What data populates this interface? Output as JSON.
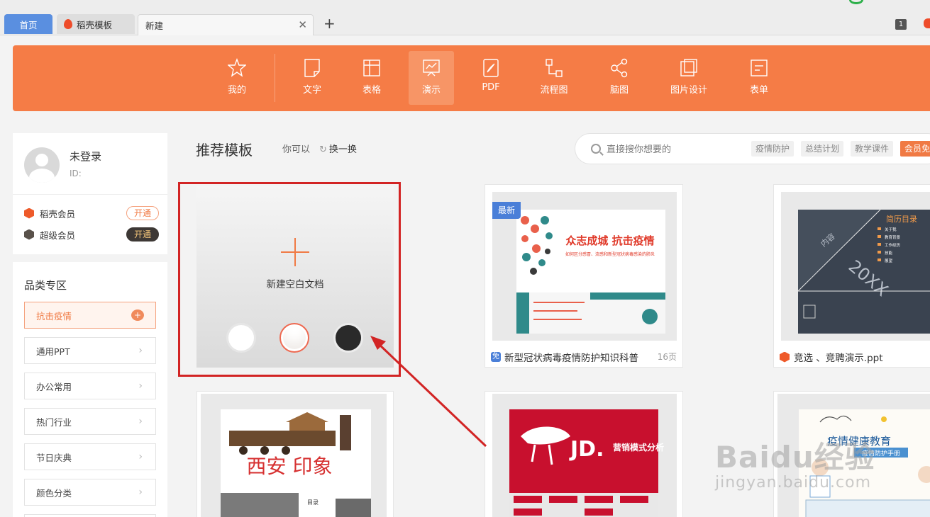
{
  "tabs": {
    "home": "首页",
    "daoke": "稻壳模板",
    "new": "新建",
    "window_count": "1"
  },
  "nav": [
    {
      "label": "我的",
      "icon": "star-icon"
    },
    {
      "label": "文字",
      "icon": "document-icon"
    },
    {
      "label": "表格",
      "icon": "table-icon"
    },
    {
      "label": "演示",
      "icon": "presentation-icon",
      "active": true
    },
    {
      "label": "PDF",
      "icon": "pdf-icon"
    },
    {
      "label": "流程图",
      "icon": "flowchart-icon"
    },
    {
      "label": "脑图",
      "icon": "mindmap-icon"
    },
    {
      "label": "图片设计",
      "icon": "image-design-icon"
    },
    {
      "label": "表单",
      "icon": "form-icon"
    }
  ],
  "user": {
    "name": "未登录",
    "id_label": "ID:",
    "members": [
      {
        "label": "稻壳会员",
        "button": "开通"
      },
      {
        "label": "超级会员",
        "button": "开通"
      }
    ]
  },
  "categories": {
    "title": "品类专区",
    "items": [
      "抗击疫情",
      "通用PPT",
      "办公常用",
      "热门行业",
      "节日庆典",
      "颜色分类"
    ],
    "badge": "+"
  },
  "content": {
    "title": "推荐模板",
    "hint": "你可以",
    "refresh": "换一换"
  },
  "search": {
    "placeholder": "直接搜你想要的",
    "tags": [
      "疫情防护",
      "总结计划",
      "教学课件",
      "会员免"
    ]
  },
  "blank_doc": {
    "label": "新建空白文档"
  },
  "cards": [
    {
      "title": "新型冠状病毒疫情防护知识科普",
      "pages": "16页",
      "tag": "免",
      "badge": "最新"
    },
    {
      "title": "竞选 、竞聘演示.ppt",
      "pages": ""
    }
  ],
  "thumb_text": {
    "covid_head": "众志成城  抗击疫情",
    "covid_sub": "如何区分感冒、流感和新型冠状病毒感染的肺炎",
    "resume_title": "简历目录",
    "resume_items": [
      "关于我",
      "教育背景",
      "工作经历",
      "技能",
      "展望"
    ],
    "resume_year": "20XX",
    "resume_content": "内容",
    "xian_title": "西安 印象",
    "xian_sub": "目录",
    "jd_logo": "JD.",
    "jd_title": "营销模式分析",
    "health_title": "疫情健康教育",
    "health_sub": "疫情防护手册"
  },
  "watermark": {
    "logo": "Baidu经验",
    "url": "jingyan.baidu.com"
  },
  "colors": {
    "accent": "#f57c46",
    "tab_home": "#5a8fe0",
    "highlight": "#d22424"
  }
}
